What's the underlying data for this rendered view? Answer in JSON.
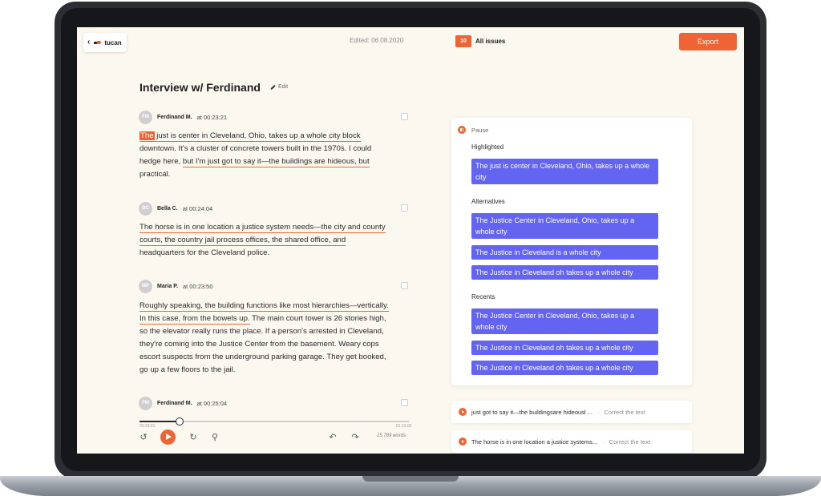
{
  "header": {
    "back_icon": "chevron-left-icon",
    "logo_text": "tucan",
    "edited": "Edited: 06.08.2020",
    "issues_count": "10",
    "issues_label": "All issues",
    "export_label": "Export"
  },
  "document": {
    "title": "Interview w/ Ferdinand",
    "edit_label": "Edit",
    "entries": [
      {
        "initials": "FM",
        "name": "Ferdinand M.",
        "time": "at 00:23:21",
        "highlighted_word": "The",
        "line1_rest": " just is center in Cleveland, Ohio, takes up a whole city block",
        "line2": "downtown. It's a cluster of concrete towers built in the 1970s. I could",
        "line3_plain": "hedge here, ",
        "line3_ul": "but I'm just got to say it—the buildings are hideous, but",
        "line4": "practical."
      },
      {
        "initials": "BC",
        "name": "Bella C.",
        "time": "at 00:24:04",
        "line1": "The horse is in one location a justice system needs—the city and county",
        "line2": "courts, the country jail process offices, the shared office, and",
        "line3": "headquarters for the Cleveland police."
      },
      {
        "initials": "MP",
        "name": "Maria P.",
        "time": "at 00:23:50",
        "line1": "Roughly speaking, the building functions like most hierarchies—vertically.",
        "line2_ul": "In this case, from the bowels up.",
        "line2_rest": " The main court tower is 26 stories high,",
        "line3": "so the elevator really runs the place. If a person's arrested in Cleveland,",
        "line4": "they're coming into the Justice Center from the basement. Weary cops",
        "line5": "escort suspects from the underground parking garage. They get booked,",
        "line6": "go up a few floors to the jail."
      },
      {
        "initials": "FM",
        "name": "Ferdinand M.",
        "time": "at 00:25:04"
      }
    ]
  },
  "player": {
    "progress": 0.15,
    "time_start": "00:23:21",
    "time_end": "01:12:00",
    "rewind_icon": "rewind-icon",
    "play_icon": "play-icon",
    "forward_icon": "forward-icon",
    "search_icon": "search-icon",
    "undo_icon": "undo-icon",
    "redo_icon": "redo-icon",
    "word_count": "15,789 words"
  },
  "suggestions": {
    "pause_label": "Pause",
    "highlighted_label": "Highlighted",
    "highlighted": "The just is center in Cleveland, Ohio, takes up a whole city",
    "alternatives_label": "Alternatives",
    "alternatives": [
      "The Justice Center in Cleveland, Ohio, takes up a whole city",
      "The Justice in Cleveland is a whole city",
      "The Justice in Cleveland oh takes up a whole city"
    ],
    "recents_label": "Recents",
    "recents": [
      "The Justice Center in Cleveland, Ohio, takes up a whole city",
      "The Justice in Cleveland oh takes up a whole city",
      "The Justice in Cleveland oh takes up a whole city"
    ]
  },
  "issues": [
    {
      "text": "just got to say it—the buildingsare hideousl ...",
      "action": "Correct the text"
    },
    {
      "text": "The horse is in one location a justice systems...",
      "action": "Correct the text"
    }
  ],
  "colors": {
    "accent": "#ef6434",
    "suggestion": "#6464f2",
    "background": "#fbf8ef"
  }
}
